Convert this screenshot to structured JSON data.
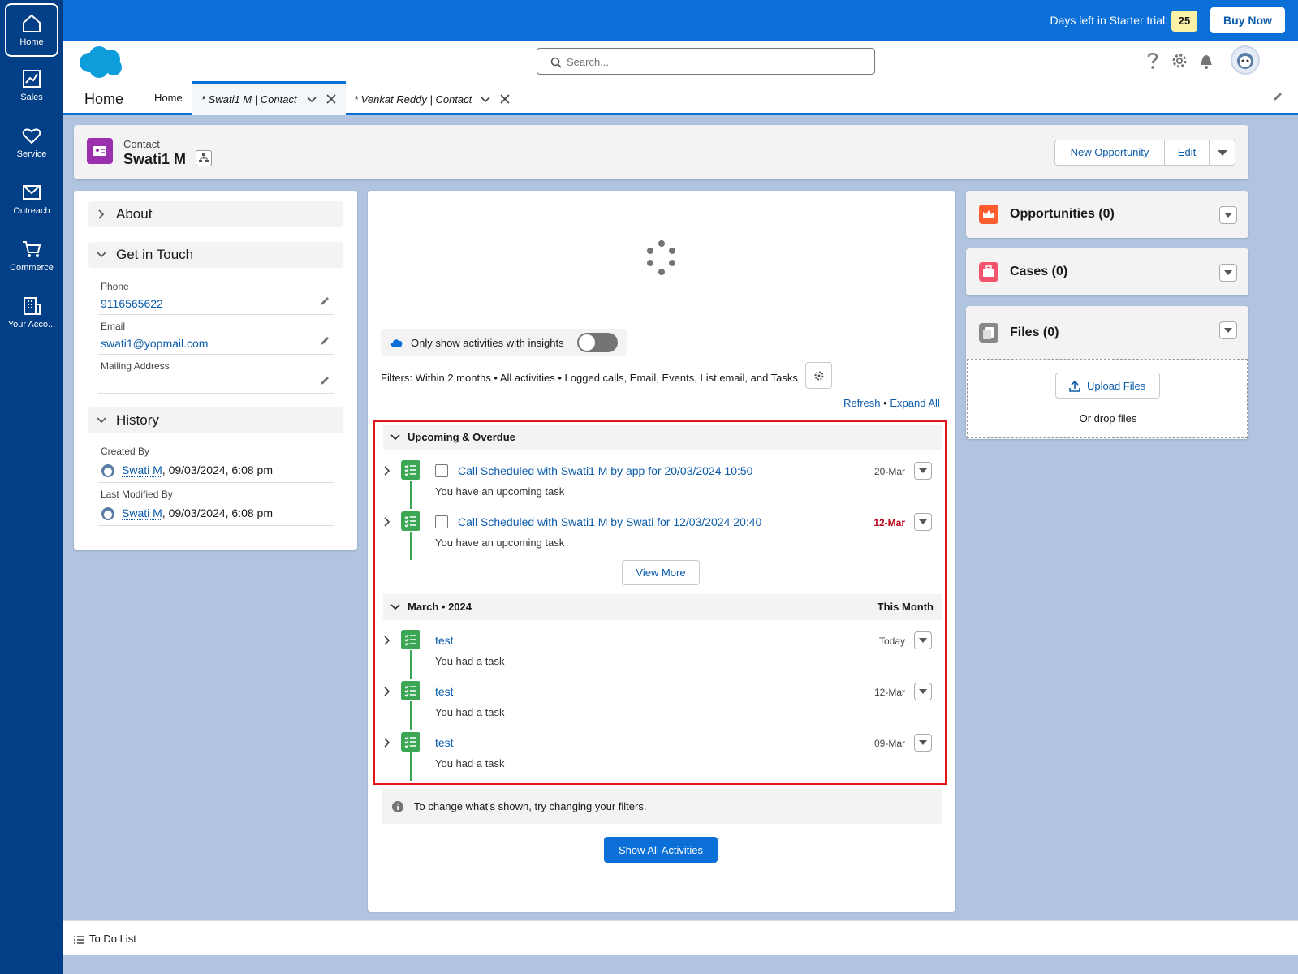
{
  "rail": {
    "items": [
      {
        "label": "Home"
      },
      {
        "label": "Sales"
      },
      {
        "label": "Service"
      },
      {
        "label": "Outreach"
      },
      {
        "label": "Commerce"
      },
      {
        "label": "Your Acco..."
      }
    ]
  },
  "topbar": {
    "trial_text": "Days left in Starter trial:",
    "trial_count": "25",
    "buy_now": "Buy Now"
  },
  "header": {
    "search_placeholder": "Search...",
    "app_name": "Home",
    "tabs": [
      {
        "label": "Home"
      },
      {
        "label": "* Swati1 M | Contact"
      },
      {
        "label": "* Venkat Reddy | Contact"
      }
    ]
  },
  "record": {
    "object": "Contact",
    "name": "Swati1 M",
    "buttons": {
      "new_opportunity": "New Opportunity",
      "edit": "Edit"
    }
  },
  "details": {
    "about": "About",
    "get_in_touch": "Get in Touch",
    "phone_label": "Phone",
    "phone": "9116565622",
    "email_label": "Email",
    "email": "swati1@yopmail.com",
    "mailing_label": "Mailing Address",
    "history": "History",
    "created_by_label": "Created By",
    "created_by": "Swati M",
    "created_date": ", 09/03/2024, 6:08 pm",
    "modified_by_label": "Last Modified By",
    "modified_by": "Swati M",
    "modified_date": ", 09/03/2024, 6:08 pm"
  },
  "activity": {
    "insights_toggle": "Only show activities with insights",
    "filters": "Filters: Within 2 months • All activities • Logged calls, Email, Events, List email, and Tasks",
    "refresh": "Refresh",
    "bullet": "•",
    "expand_all": "Expand All",
    "upcoming": {
      "title": "Upcoming & Overdue",
      "items": [
        {
          "title": "Call Scheduled with Swati1 M by app for 20/03/2024 10:50",
          "subtitle": "You have an upcoming task",
          "date": "20-Mar"
        },
        {
          "title": "Call Scheduled with Swati1 M by Swati for 12/03/2024 20:40",
          "subtitle": "You have an upcoming task",
          "date": "12-Mar"
        }
      ],
      "view_more": "View More"
    },
    "month": {
      "title": "March • 2024",
      "right": "This Month",
      "items": [
        {
          "title": "test",
          "subtitle": "You had a task",
          "date": "Today"
        },
        {
          "title": "test",
          "subtitle": "You had a task",
          "date": "12-Mar"
        },
        {
          "title": "test",
          "subtitle": "You had a task",
          "date": "09-Mar"
        }
      ]
    },
    "info": "To change what's shown, try changing your filters.",
    "show_all": "Show All Activities",
    "overdue_color": "#ba0517"
  },
  "related": {
    "opportunities": "Opportunities (0)",
    "cases": "Cases (0)",
    "files": "Files (0)",
    "upload": "Upload Files",
    "drop": "Or drop files"
  },
  "footer": {
    "todo": "To Do List"
  },
  "colors": {
    "brand": "#0b6fd8",
    "rail": "#033f86",
    "task_green": "#3ba755",
    "highlight": "#e4141b"
  }
}
